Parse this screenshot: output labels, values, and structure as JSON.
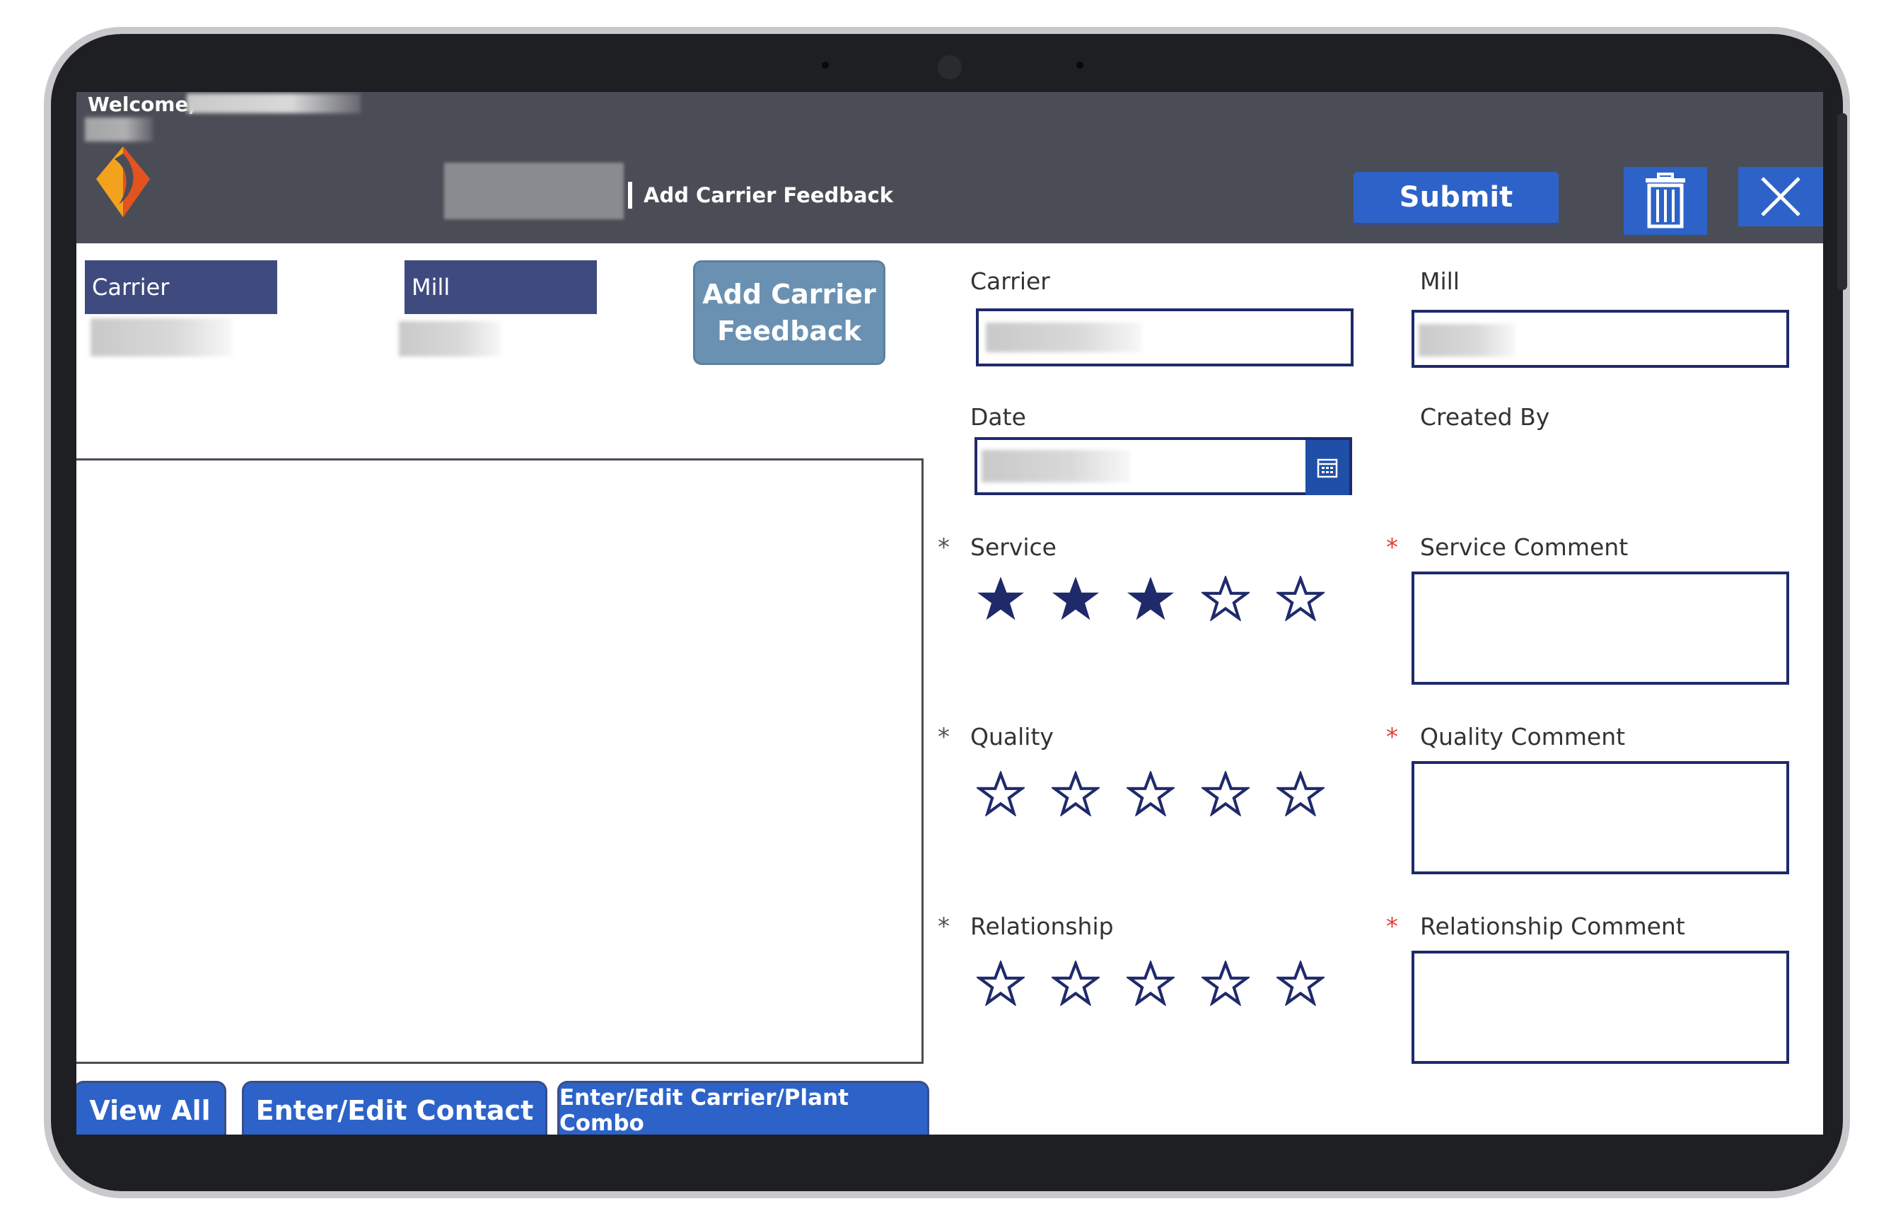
{
  "header": {
    "welcome": "Welcome,",
    "page_title": "Add Carrier Feedback",
    "submit_label": "Submit"
  },
  "left_panel": {
    "carrier_label": "Carrier",
    "mill_label": "Mill",
    "add_feedback_label": "Add Carrier Feedback"
  },
  "bottom_buttons": {
    "view_all": "View All",
    "enter_edit_contact": "Enter/Edit Contact",
    "enter_edit_combo": "Enter/Edit Carrier/Plant Combo"
  },
  "form": {
    "carrier_label": "Carrier",
    "mill_label": "Mill",
    "date_label": "Date",
    "created_by_label": "Created By",
    "required_marker": "*",
    "service": {
      "label": "Service",
      "rating": 3,
      "max": 5,
      "comment_label": "Service Comment"
    },
    "quality": {
      "label": "Quality",
      "rating": 0,
      "max": 5,
      "comment_label": "Quality Comment"
    },
    "relationship": {
      "label": "Relationship",
      "rating": 0,
      "max": 5,
      "comment_label": "Relationship Comment"
    }
  },
  "colors": {
    "header_bg": "#4b4d56",
    "primary_button": "#2d63c8",
    "label_header": "#3f4b7e",
    "star": "#1f2a6b",
    "required_red": "#e0423a",
    "required_gray": "#555555"
  }
}
